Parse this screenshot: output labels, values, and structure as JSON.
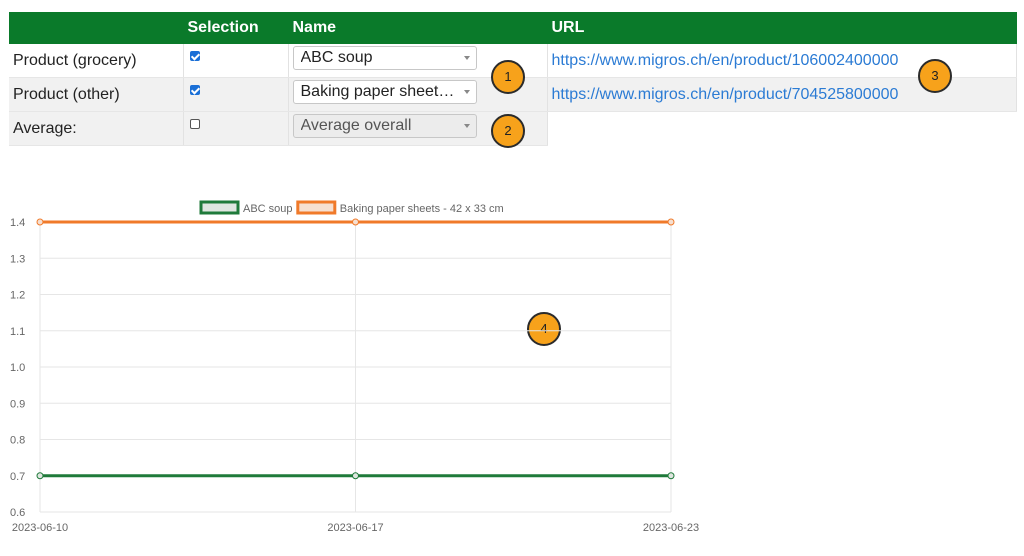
{
  "table": {
    "headers": [
      "",
      "Selection",
      "Name",
      "URL"
    ],
    "rows": [
      {
        "label": "Product (grocery)",
        "checked": true,
        "select": "ABC soup",
        "disabled": false,
        "url": "https://www.migros.ch/en/product/106002400000"
      },
      {
        "label": "Product (other)",
        "checked": true,
        "select": "Baking paper sheets - 42 x 33 cm",
        "disabled": false,
        "url": "https://www.migros.ch/en/product/704525800000"
      },
      {
        "label": "Average:",
        "checked": false,
        "select": "Average overall",
        "disabled": true,
        "url": ""
      }
    ]
  },
  "badges": [
    "1",
    "2",
    "3",
    "4"
  ],
  "chart_data": {
    "type": "line",
    "x": [
      "2023-06-10",
      "2023-06-17",
      "2023-06-23"
    ],
    "ylim": [
      0.6,
      1.4
    ],
    "yticks": [
      "0.6",
      "0.7",
      "0.8",
      "0.9",
      "1.0",
      "1.1",
      "1.2",
      "1.3",
      "1.4"
    ],
    "series": [
      {
        "name": "ABC soup",
        "values": [
          0.7,
          0.7,
          0.7
        ],
        "color": "#1f7a3a",
        "fill": "#dfe6e0"
      },
      {
        "name": "Baking paper sheets - 42 x 33 cm",
        "values": [
          1.4,
          1.4,
          1.4
        ],
        "color": "#f07a2a",
        "fill": "#f6dfd0"
      }
    ],
    "grid": true,
    "legend": "top"
  }
}
